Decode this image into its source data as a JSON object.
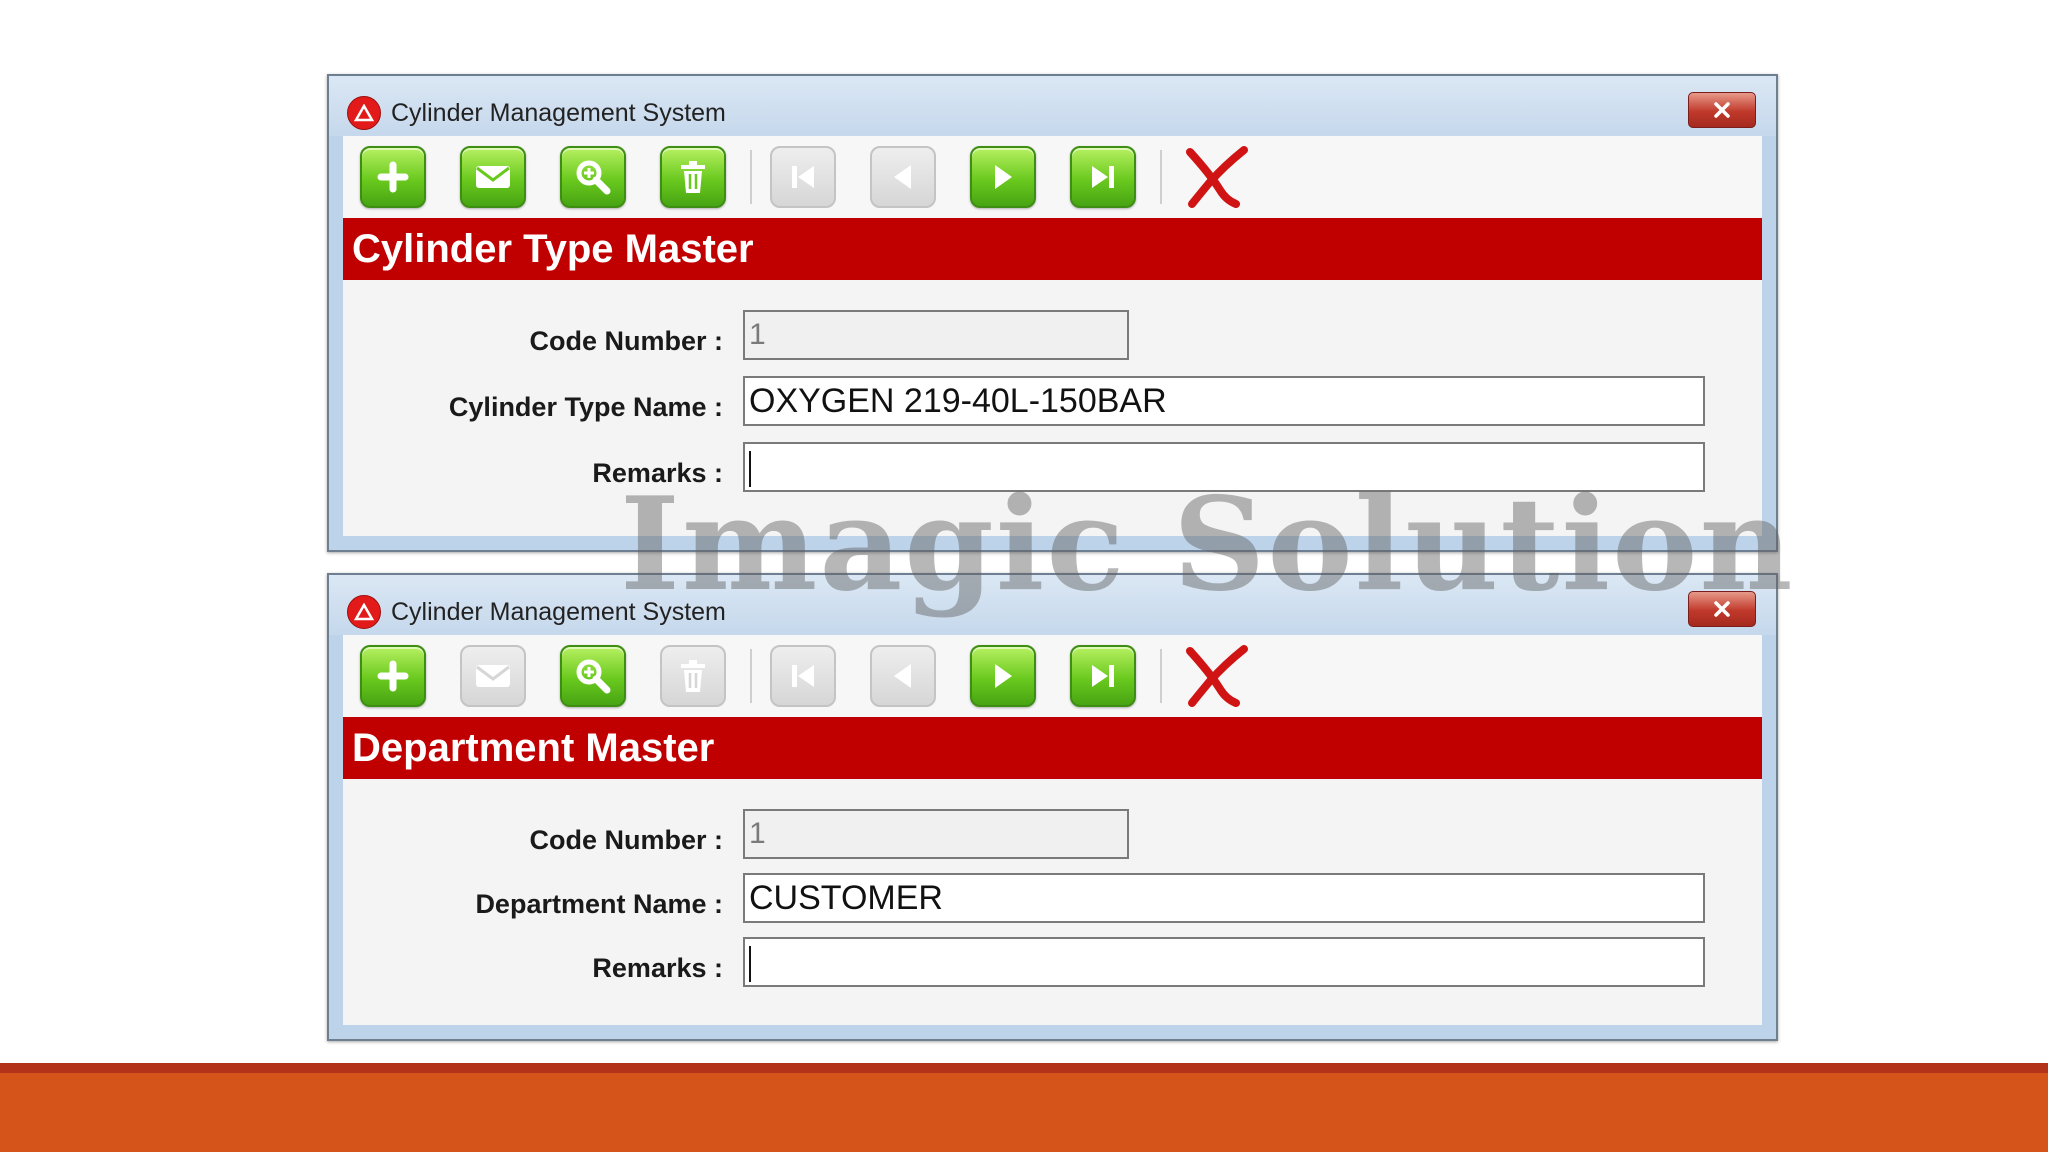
{
  "windows": [
    {
      "title": "Cylinder Management System",
      "heading": "Cylinder Type Master",
      "toolbar": {
        "add": {
          "icon": "plus-icon",
          "enabled": true
        },
        "edit": {
          "icon": "envelope-icon",
          "enabled": true
        },
        "search": {
          "icon": "magnifier-icon",
          "enabled": true
        },
        "delete": {
          "icon": "trash-icon",
          "enabled": true
        },
        "first": {
          "icon": "first-record-icon",
          "enabled": false
        },
        "previous": {
          "icon": "previous-record-icon",
          "enabled": false
        },
        "next": {
          "icon": "next-record-icon",
          "enabled": true
        },
        "last": {
          "icon": "last-record-icon",
          "enabled": true
        },
        "cancel": {
          "icon": "red-x-icon",
          "enabled": true
        }
      },
      "fields": [
        {
          "label": "Code Number :",
          "value": "1"
        },
        {
          "label": "Cylinder Type Name :",
          "value": "OXYGEN 219-40L-150BAR"
        },
        {
          "label": "Remarks :",
          "value": ""
        }
      ]
    },
    {
      "title": "Cylinder Management System",
      "heading": "Department Master",
      "toolbar": {
        "add": {
          "icon": "plus-icon",
          "enabled": true
        },
        "edit": {
          "icon": "envelope-icon",
          "enabled": false
        },
        "search": {
          "icon": "magnifier-icon",
          "enabled": true
        },
        "delete": {
          "icon": "trash-icon",
          "enabled": false
        },
        "first": {
          "icon": "first-record-icon",
          "enabled": false
        },
        "previous": {
          "icon": "previous-record-icon",
          "enabled": false
        },
        "next": {
          "icon": "next-record-icon",
          "enabled": true
        },
        "last": {
          "icon": "last-record-icon",
          "enabled": true
        },
        "cancel": {
          "icon": "red-x-icon",
          "enabled": true
        }
      },
      "fields": [
        {
          "label": "Code Number :",
          "value": "1"
        },
        {
          "label": "Department Name :",
          "value": "CUSTOMER"
        },
        {
          "label": "Remarks :",
          "value": ""
        }
      ]
    }
  ],
  "watermark": "Imagic Solution",
  "colors": {
    "banner": "#c00000",
    "button_enabled": "#6ac91e",
    "button_disabled": "#d6d6d6",
    "footer": "#d4541a"
  }
}
